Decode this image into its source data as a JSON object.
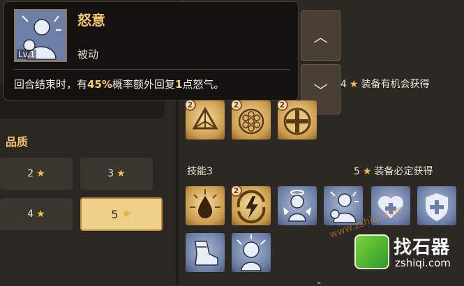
{
  "tooltip": {
    "skill_name": "怒意",
    "level": "Lv.1",
    "type": "被动",
    "desc_before": "回合结束时，有",
    "desc_percent": "45%",
    "desc_mid": "概率额外回复",
    "desc_amount": "1",
    "desc_after": "点怒气。",
    "icon": "angry-hero-icon"
  },
  "quality": {
    "title": "品质",
    "options": [
      {
        "label": "2",
        "icon": "star-icon",
        "selected": false
      },
      {
        "label": "3",
        "icon": "star-icon",
        "selected": false
      },
      {
        "label": "4",
        "icon": "star-icon",
        "selected": false
      },
      {
        "label": "5",
        "icon": "star-icon",
        "selected": true
      }
    ]
  },
  "scroll": {
    "up_icon": "chevron-up-icon",
    "down_icon": "chevron-down-icon"
  },
  "skill_rows": [
    {
      "title": "",
      "stars": "4",
      "note": "装备有机会获得",
      "skills": [
        {
          "icon": "pyramid-icon",
          "badge": "2",
          "style": "gold"
        },
        {
          "icon": "honeycomb-ball-icon",
          "badge": "2",
          "style": "gold"
        },
        {
          "icon": "cross-shield-icon",
          "badge": "2",
          "style": "gold"
        }
      ]
    },
    {
      "title": "技能3",
      "stars": "5",
      "note": "装备必定获得",
      "skills": [
        {
          "icon": "blood-drop-icon",
          "badge": "",
          "style": "gold"
        },
        {
          "icon": "lightning-swirl-icon",
          "badge": "2",
          "style": "gold"
        },
        {
          "icon": "angel-figure-icon",
          "badge": "",
          "style": "blue"
        },
        {
          "icon": "angry-hero-icon",
          "badge": "",
          "style": "blue"
        },
        {
          "icon": "heart-plus-icon",
          "badge": "",
          "style": "blue"
        },
        {
          "icon": "shield-plus-icon",
          "badge": "",
          "style": "blue"
        },
        {
          "icon": "boot-icon",
          "badge": "",
          "style": "blue"
        },
        {
          "icon": "rage-face-icon",
          "badge": "",
          "style": "blue"
        }
      ]
    }
  ],
  "watermark": {
    "cn": "找石器",
    "en": "zshiqi.com",
    "url": "www.zshiqi.com"
  },
  "down_hint": "⌄",
  "colors": {
    "accent": "#f3c56a",
    "star": "#f1c43c",
    "highlight": "#f3d26a"
  }
}
